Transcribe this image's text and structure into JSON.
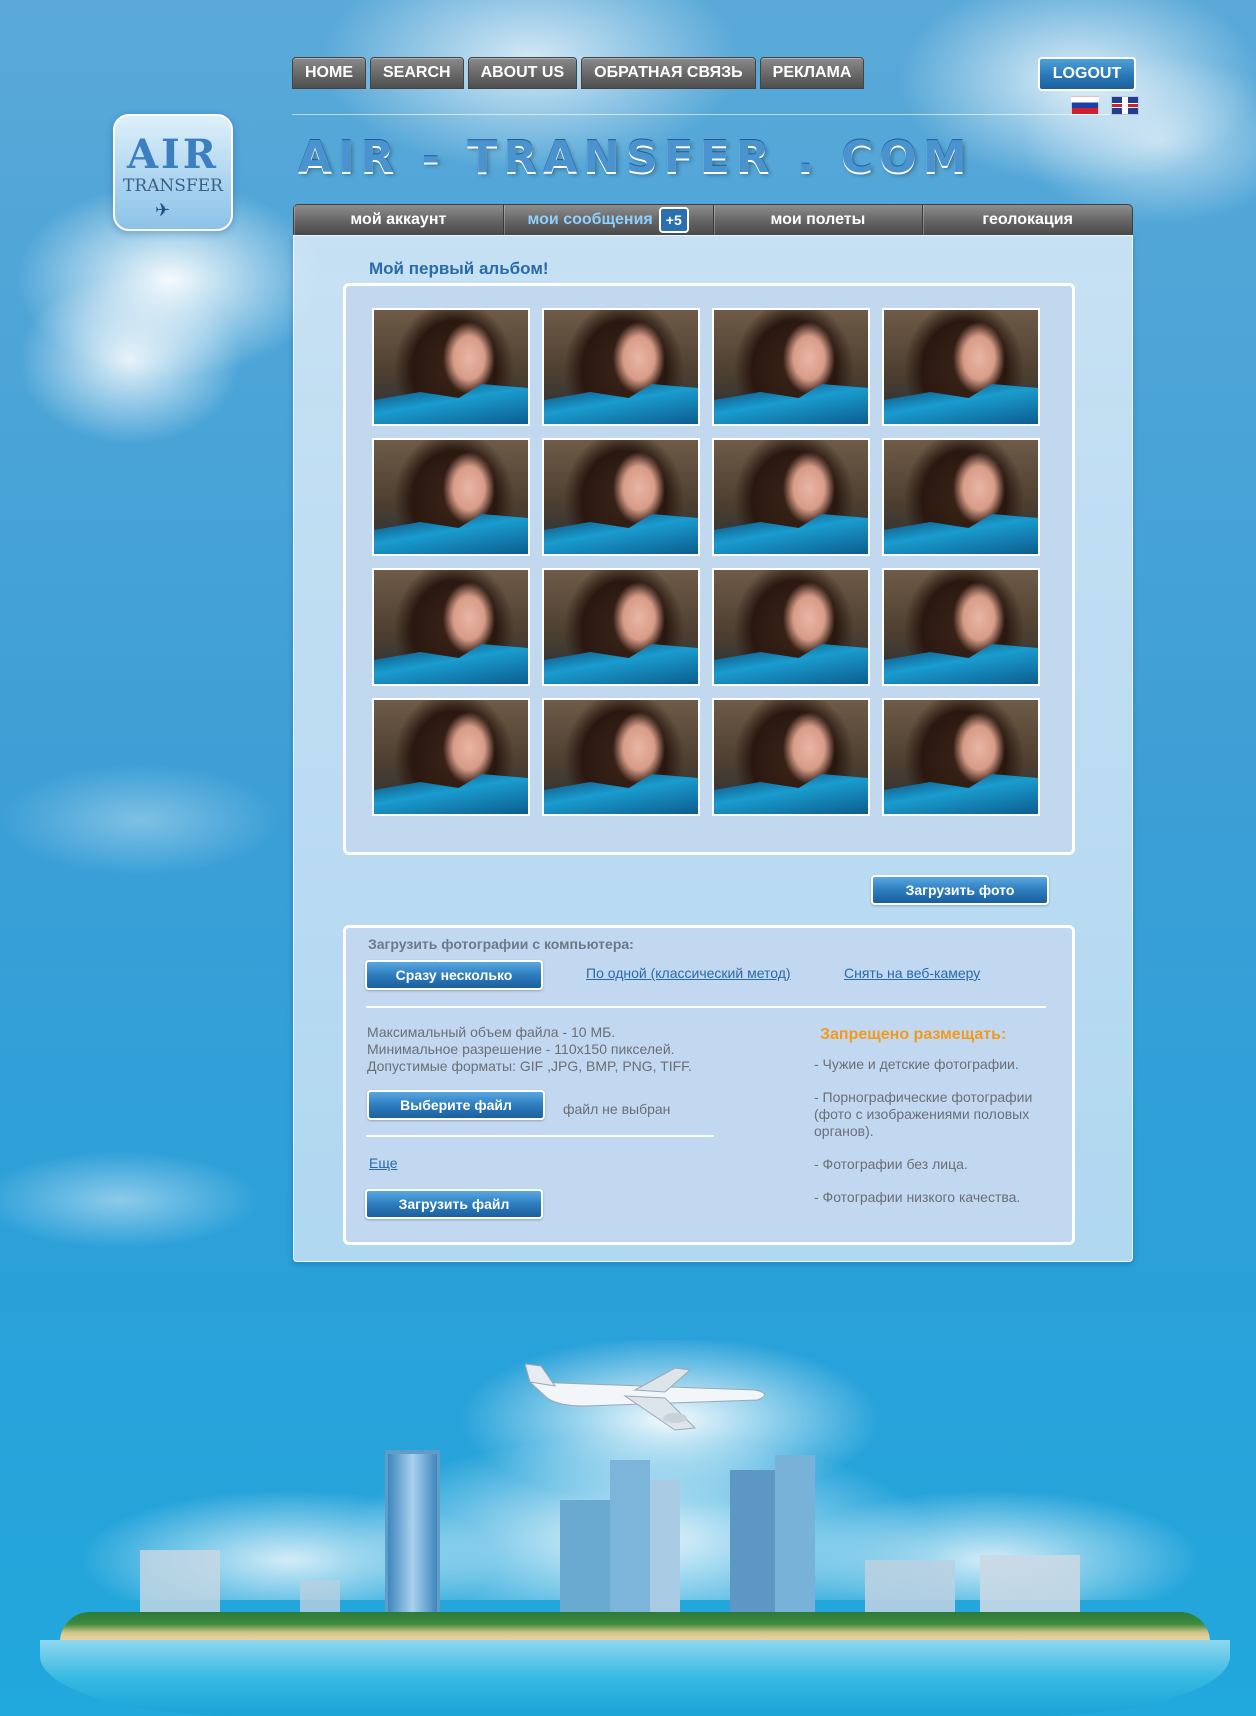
{
  "top_nav": {
    "items": [
      {
        "label": "HOME"
      },
      {
        "label": "SEARCH"
      },
      {
        "label": "ABOUT US"
      },
      {
        "label": "ОБРАТНАЯ СВЯЗЬ"
      },
      {
        "label": "РЕКЛАМА"
      }
    ],
    "logout_label": "LOGOUT"
  },
  "languages": [
    {
      "code": "ru",
      "icon": "flag-russia-icon"
    },
    {
      "code": "en",
      "icon": "flag-uk-icon"
    }
  ],
  "logo": {
    "line1": "AIR",
    "line2": "TRANSFER"
  },
  "site_title": "AIR - TRANSFER . COM",
  "main_tabs": [
    {
      "label": "мой аккаунт",
      "active": false
    },
    {
      "label": "мои сообщения",
      "active": true,
      "badge": "+5"
    },
    {
      "label": "мои полеты",
      "active": false
    },
    {
      "label": "геолокация",
      "active": false
    }
  ],
  "album": {
    "title": "Мой первый альбом!",
    "photo_count": 16
  },
  "upload_photo_label": "Загрузить фото",
  "upload": {
    "heading": "Загрузить фотографии с компьютера:",
    "multiple_label": "Сразу несколько",
    "one_by_one_link": "По одной (классический метод)",
    "webcam_link": "Снять на веб-камеру",
    "info": [
      "Максимальный объем файла - 10 МБ.",
      "Минимальное разрешение - 110x150 пикселей.",
      "Допустимые форматы: GIF ,JPG, BMP, PNG, TIFF."
    ],
    "choose_file_label": "Выберите файл",
    "no_file_text": "файл не выбран",
    "more_link": "Еще",
    "upload_file_label": "Загрузить файл"
  },
  "forbidden": {
    "title": "Запрещено размещать:",
    "items": [
      "- Чужие и детские фотографии.",
      "- Порнографические фотографии (фото с изображениями половых органов).",
      "- Фотографии без лица.",
      "- Фотографии низкого качества."
    ]
  },
  "colors": {
    "accent": "#2a6aa8",
    "warning": "#f29a1c",
    "nav_gray": "#6b6b6b"
  }
}
